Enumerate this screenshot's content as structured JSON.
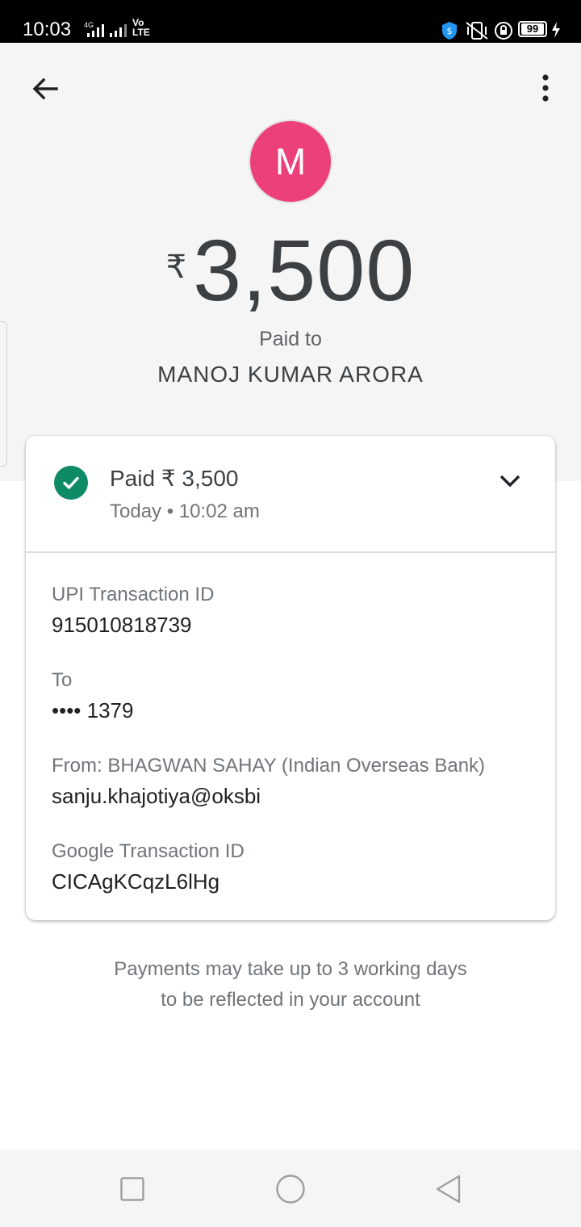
{
  "status_bar": {
    "time": "10:03",
    "network": "4G",
    "volte_top": "Vo",
    "volte_bottom": "LTE",
    "battery": "99"
  },
  "header": {
    "avatar_letter": "M",
    "avatar_color": "#ec407a",
    "currency_symbol": "₹",
    "amount": "3,500",
    "paid_to_label": "Paid to",
    "payee_name": "MANOJ KUMAR ARORA"
  },
  "card": {
    "status_title": "Paid ₹ 3,500",
    "status_time": "Today • 10:02 am",
    "status_color": "#0f8a66",
    "fields": [
      {
        "label": "UPI Transaction ID",
        "value": "915010818739"
      },
      {
        "label": "To",
        "value": "•••• 1379"
      },
      {
        "label": "From: BHAGWAN SAHAY (Indian Overseas Bank)",
        "value": "sanju.khajotiya@oksbi"
      },
      {
        "label": "Google Transaction ID",
        "value": "CICAgKCqzL6lHg"
      }
    ]
  },
  "note": {
    "line1": "Payments may take up to 3 working days",
    "line2": "to be reflected in your account"
  }
}
